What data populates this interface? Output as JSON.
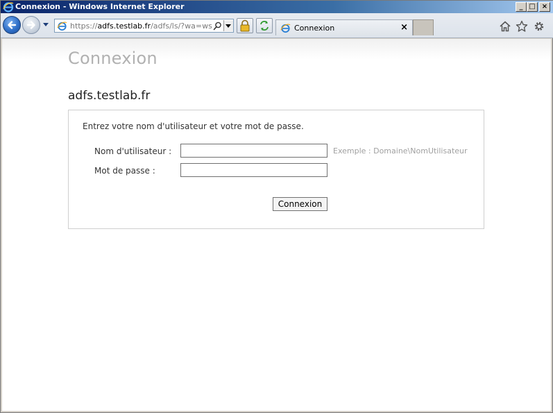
{
  "window": {
    "title": "Connexion - Windows Internet Explorer",
    "minimize_glyph": "_",
    "maximize_glyph": "□",
    "close_glyph": "×"
  },
  "toolbar": {
    "url_prefix": "https://",
    "url_domain": "adfs.testlab.fr",
    "url_rest": "/adfs/ls/?wa=wsign",
    "tab_label": "Connexion",
    "tab_close": "×"
  },
  "page": {
    "title": "Connexion",
    "site_name": "adfs.testlab.fr",
    "instructions": "Entrez votre nom d'utilisateur et votre mot de passe.",
    "username_label": "Nom d'utilisateur :",
    "username_value": "",
    "username_example": "Exemple : Domaine\\NomUtilisateur",
    "password_label": "Mot de passe :",
    "password_value": "",
    "submit_label": "Connexion"
  },
  "colors": {
    "title_gray": "#b1b1b1",
    "hint_gray": "#a0a0a0",
    "titlebar_blue": "#0a246a"
  }
}
